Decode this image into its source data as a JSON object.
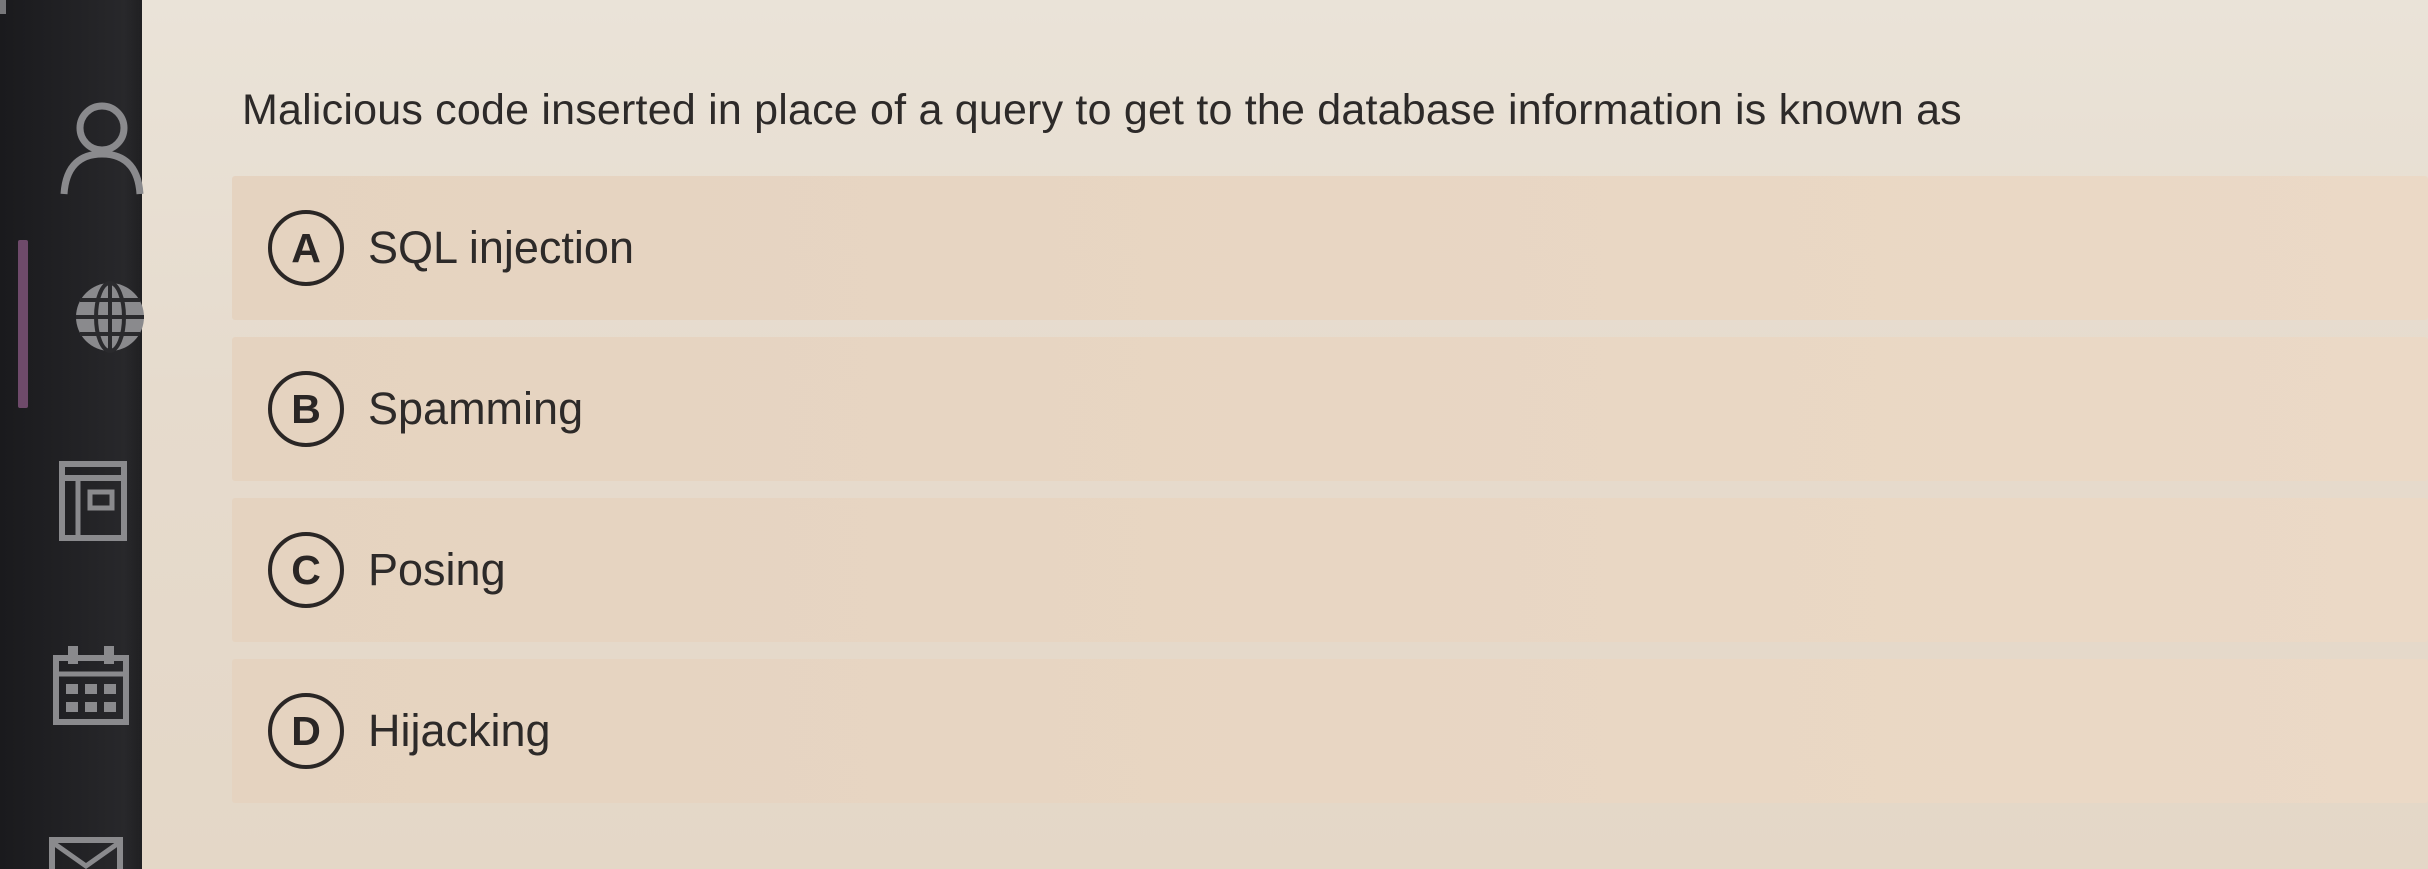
{
  "sidebar": {
    "items": [
      {
        "icon": "person-icon"
      },
      {
        "icon": "globe-icon"
      },
      {
        "icon": "panel-icon"
      },
      {
        "icon": "calendar-icon"
      },
      {
        "icon": "mail-icon"
      }
    ],
    "active_color": "#6e4a6a"
  },
  "question": {
    "text": "Malicious code inserted in place of a query to get to the database information is known as"
  },
  "options": [
    {
      "letter": "A",
      "text": "SQL injection"
    },
    {
      "letter": "B",
      "text": "Spamming"
    },
    {
      "letter": "C",
      "text": "Posing"
    },
    {
      "letter": "D",
      "text": "Hijacking"
    }
  ],
  "colors": {
    "page_bg": "#e6dccf",
    "option_bg": "#e8d6c3",
    "text": "#2d2a29",
    "sidebar_bg": "#232326"
  }
}
